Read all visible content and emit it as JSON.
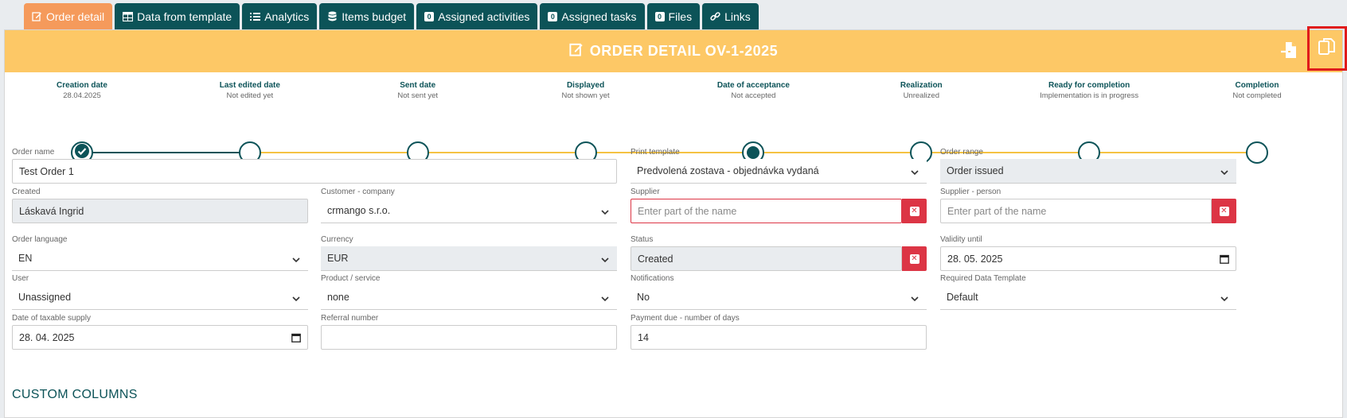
{
  "tabs": [
    {
      "label": "Order detail",
      "icon": "edit-icon",
      "active": true
    },
    {
      "label": "Data from template",
      "icon": "table-icon"
    },
    {
      "label": "Analytics",
      "icon": "list-icon"
    },
    {
      "label": "Items budget",
      "icon": "database-icon"
    },
    {
      "label": "Assigned activities",
      "badge": "0"
    },
    {
      "label": "Assigned tasks",
      "badge": "0"
    },
    {
      "label": "Files",
      "badge": "0"
    },
    {
      "label": "Links",
      "icon": "link-icon"
    }
  ],
  "header": {
    "title": "ORDER DETAIL OV-1-2025",
    "title_icon": "edit-icon",
    "buttons": [
      "export-icon",
      "copy-icon"
    ]
  },
  "timeline": {
    "progress_step_index": 1,
    "steps": [
      {
        "label": "Creation date",
        "sub": "28.04.2025",
        "state": "done"
      },
      {
        "label": "Last edited date",
        "sub": "Not edited yet",
        "state": "empty"
      },
      {
        "label": "Sent date",
        "sub": "Not sent yet",
        "state": "empty"
      },
      {
        "label": "Displayed",
        "sub": "Not shown yet",
        "state": "empty"
      },
      {
        "label": "Date of acceptance",
        "sub": "Not accepted",
        "state": "current"
      },
      {
        "label": "Realization",
        "sub": "Unrealized",
        "state": "empty"
      },
      {
        "label": "Ready for completion",
        "sub": "Implementation is in progress",
        "state": "empty"
      },
      {
        "label": "Completion",
        "sub": "Not completed",
        "state": "empty"
      }
    ],
    "colors": {
      "done": "#0c5358",
      "pending": "#f5c242"
    }
  },
  "form": {
    "order_name": {
      "label": "Order name",
      "value": "Test Order 1"
    },
    "print_template": {
      "label": "Print template",
      "value": "Predvolená zostava - objednávka vydaná"
    },
    "order_range": {
      "label": "Order range",
      "value": "Order issued"
    },
    "created": {
      "label": "Created",
      "value": "Láskavá Ingrid"
    },
    "customer_company": {
      "label": "Customer - company",
      "value": "crmango s.r.o."
    },
    "supplier": {
      "label": "Supplier",
      "placeholder": "Enter part of the name"
    },
    "supplier_person": {
      "label": "Supplier - person",
      "placeholder": "Enter part of the name"
    },
    "order_language": {
      "label": "Order language",
      "value": "EN"
    },
    "currency": {
      "label": "Currency",
      "value": "EUR"
    },
    "status": {
      "label": "Status",
      "value": "Created"
    },
    "validity_until": {
      "label": "Validity until",
      "value": "28. 05. 2025"
    },
    "user": {
      "label": "User",
      "value": "Unassigned"
    },
    "product_service": {
      "label": "Product / service",
      "value": "none"
    },
    "notifications": {
      "label": "Notifications",
      "value": "No"
    },
    "required_data_template": {
      "label": "Required Data Template",
      "value": "Default"
    },
    "date_taxable_supply": {
      "label": "Date of taxable supply",
      "value": "28. 04. 2025"
    },
    "referral_number": {
      "label": "Referral number",
      "value": ""
    },
    "payment_due": {
      "label": "Payment due - number of days",
      "value": "14"
    }
  },
  "custom_columns_title": "CUSTOM COLUMNS"
}
